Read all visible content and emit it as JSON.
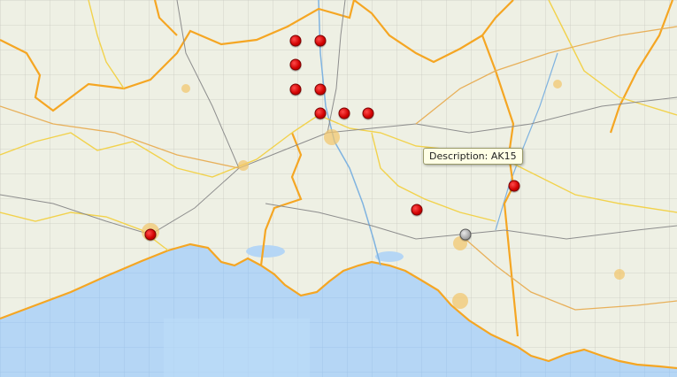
{
  "map": {
    "tooltip": {
      "text": "Description: AK15"
    },
    "colors": {
      "sea": "#b5d6f5",
      "land": "#eef0e4",
      "border": "#f5a623",
      "marker_red": "#d00000",
      "marker_grey": "#a9a9a9"
    },
    "markers": [
      {
        "name": "marker-1",
        "color": "red"
      },
      {
        "name": "marker-2",
        "color": "red"
      },
      {
        "name": "marker-3",
        "color": "red"
      },
      {
        "name": "marker-4",
        "color": "red"
      },
      {
        "name": "marker-5",
        "color": "red"
      },
      {
        "name": "marker-6",
        "color": "red"
      },
      {
        "name": "marker-7",
        "color": "red"
      },
      {
        "name": "marker-8",
        "color": "red"
      },
      {
        "name": "marker-9",
        "color": "red"
      },
      {
        "name": "marker-10",
        "color": "red"
      },
      {
        "name": "marker-11",
        "color": "red"
      },
      {
        "name": "marker-12",
        "color": "red"
      },
      {
        "name": "marker-13",
        "color": "grey"
      }
    ]
  }
}
